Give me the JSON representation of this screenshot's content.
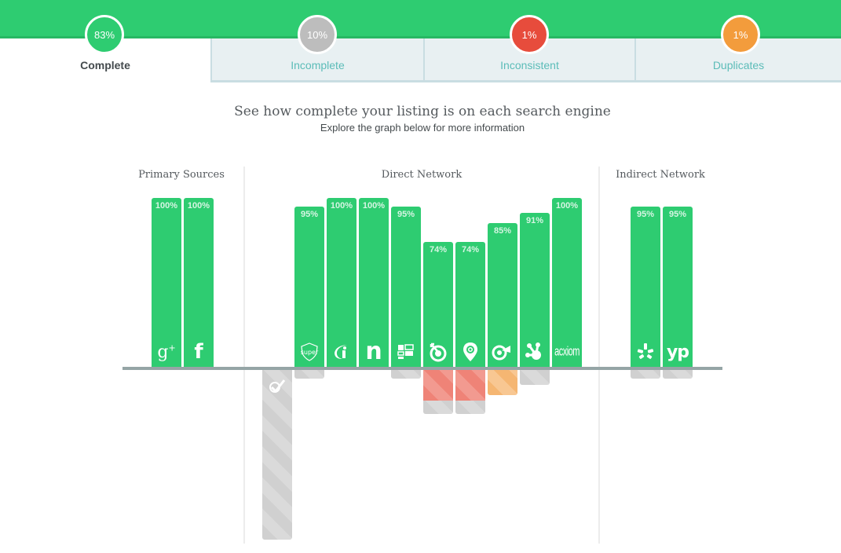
{
  "colors": {
    "brand_green": "#2ecc71",
    "complete": "#2ecc71",
    "incomplete": "#bdbdbd",
    "inconsistent": "#e74c3c",
    "duplicates": "#f39c3c",
    "tab_text": "#5bbcb8"
  },
  "tabs": [
    {
      "label": "Complete",
      "value": "83%",
      "color": "#2ecc71",
      "active": true
    },
    {
      "label": "Incomplete",
      "value": "10%",
      "color": "#bdbdbd",
      "active": false
    },
    {
      "label": "Inconsistent",
      "value": "1%",
      "color": "#e74c3c",
      "active": false
    },
    {
      "label": "Duplicates",
      "value": "1%",
      "color": "#f39c3c",
      "active": false
    }
  ],
  "intro": {
    "headline": "See how complete your listing is on each search engine",
    "subline": "Explore the graph below for more information"
  },
  "chart_data": {
    "type": "bar",
    "title": "See how complete your listing is on each search engine",
    "ylim": [
      -100,
      100
    ],
    "grid": false,
    "groups": [
      {
        "name": "Primary Sources",
        "sources": [
          {
            "icon": "google-plus-icon",
            "label": "g+",
            "complete": 100,
            "incomplete": 0,
            "inconsistent": 0,
            "duplicates": 0,
            "missing": 0
          },
          {
            "icon": "facebook-icon",
            "label": "f",
            "complete": 100,
            "incomplete": 0,
            "inconsistent": 0,
            "duplicates": 0,
            "missing": 0
          }
        ]
      },
      {
        "name": "Direct Network",
        "sources": [
          {
            "icon": "checkmark-icon",
            "label": "",
            "complete": 0,
            "incomplete": 0,
            "inconsistent": 0,
            "duplicates": 0,
            "missing": 100
          },
          {
            "icon": "superpages-icon",
            "label": "super",
            "complete": 95,
            "incomplete": 5,
            "inconsistent": 0,
            "duplicates": 0,
            "missing": 0
          },
          {
            "icon": "infogroup-icon",
            "label": "i",
            "complete": 100,
            "incomplete": 0,
            "inconsistent": 0,
            "duplicates": 0,
            "missing": 0
          },
          {
            "icon": "neustar-icon",
            "label": "n",
            "complete": 100,
            "incomplete": 0,
            "inconsistent": 0,
            "duplicates": 0,
            "missing": 0
          },
          {
            "icon": "factual-icon",
            "label": "",
            "complete": 95,
            "incomplete": 5,
            "inconsistent": 0,
            "duplicates": 0,
            "missing": 0
          },
          {
            "icon": "target-icon",
            "label": "",
            "complete": 74,
            "incomplete": 8,
            "inconsistent": 18,
            "duplicates": 0,
            "missing": 0
          },
          {
            "icon": "map-pin-icon",
            "label": "",
            "complete": 74,
            "incomplete": 8,
            "inconsistent": 18,
            "duplicates": 0,
            "missing": 0
          },
          {
            "icon": "bullseye-megaphone-icon",
            "label": "",
            "complete": 85,
            "incomplete": 0,
            "inconsistent": 0,
            "duplicates": 15,
            "missing": 0
          },
          {
            "icon": "frog-foot-icon",
            "label": "",
            "complete": 91,
            "incomplete": 9,
            "inconsistent": 0,
            "duplicates": 0,
            "missing": 0
          },
          {
            "icon": "acxiom-icon",
            "label": "acxiom",
            "complete": 100,
            "incomplete": 0,
            "inconsistent": 0,
            "duplicates": 0,
            "missing": 0
          }
        ]
      },
      {
        "name": "Indirect Network",
        "sources": [
          {
            "icon": "yelp-icon",
            "label": "",
            "complete": 95,
            "incomplete": 5,
            "inconsistent": 0,
            "duplicates": 0,
            "missing": 0
          },
          {
            "icon": "yellow-pages-icon",
            "label": "yp",
            "complete": 95,
            "incomplete": 5,
            "inconsistent": 0,
            "duplicates": 0,
            "missing": 0
          }
        ]
      }
    ]
  }
}
